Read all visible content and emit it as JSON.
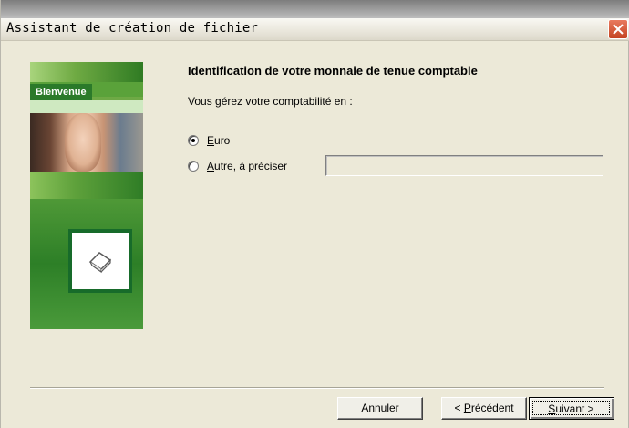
{
  "window": {
    "title": "Assistant de création de fichier"
  },
  "side_panel": {
    "label": "Bienvenue",
    "icon": "document-icon"
  },
  "main": {
    "heading": "Identification de votre monnaie de tenue comptable",
    "question": "Vous gérez votre comptabilité en :",
    "options": [
      {
        "prefix": "",
        "mnemonic": "E",
        "rest": "uro",
        "checked": true
      },
      {
        "prefix": "",
        "mnemonic": "A",
        "rest": "utre, à préciser",
        "checked": false
      }
    ],
    "other_value": ""
  },
  "buttons": {
    "cancel": "Annuler",
    "previous_prefix": "< ",
    "previous_mnemonic": "P",
    "previous_rest": "récédent",
    "next_mnemonic": "S",
    "next_rest": "uivant >"
  },
  "colors": {
    "window_bg": "#ece9d8",
    "panel_green": "#2b7a2a",
    "close_red": "#c44321"
  }
}
